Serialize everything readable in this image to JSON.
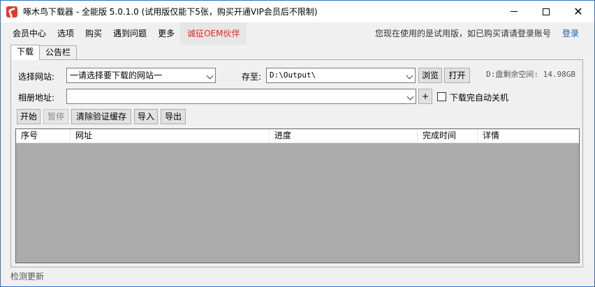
{
  "window": {
    "title": "啄木鸟下载器 - 全能版 5.0.1.0 (试用版仅能下5张，购买开通VIP会员后不限制)",
    "controls": {
      "minimize": "",
      "maximize": "",
      "close": "✕"
    }
  },
  "menu": {
    "items": [
      "会员中心",
      "选项",
      "购买",
      "遇到问题",
      "更多"
    ],
    "oem": "诚征OEM伙伴",
    "notice": "您现在使用的是试用版，如已购买请请登录账号",
    "login": "登录"
  },
  "tabs": [
    "下载",
    "公告栏"
  ],
  "form": {
    "site_label": "选择网站:",
    "site_value": "一请选择要下载的网站一",
    "save_label": "存至:",
    "save_value": "D:\\Output\\",
    "browse": "浏览",
    "open": "打开",
    "disk_info": "D:盘剩余空间: 14.98GB",
    "album_label": "相册地址:",
    "album_value": "",
    "add": "+",
    "shutdown_label": "下载完自动关机"
  },
  "toolbar": {
    "start": "开始",
    "pause": "暂停",
    "clear_cache": "清除验证缓存",
    "import": "导入",
    "export": "导出"
  },
  "list": {
    "columns": [
      "序号",
      "网址",
      "进度",
      "完成时间",
      "详情"
    ]
  },
  "status": {
    "check_update": "检测更新"
  },
  "colors": {
    "accent": "#2b74c4",
    "oem": "#e0241b",
    "login": "#1a5fb4",
    "list_bg": "#ababab"
  }
}
